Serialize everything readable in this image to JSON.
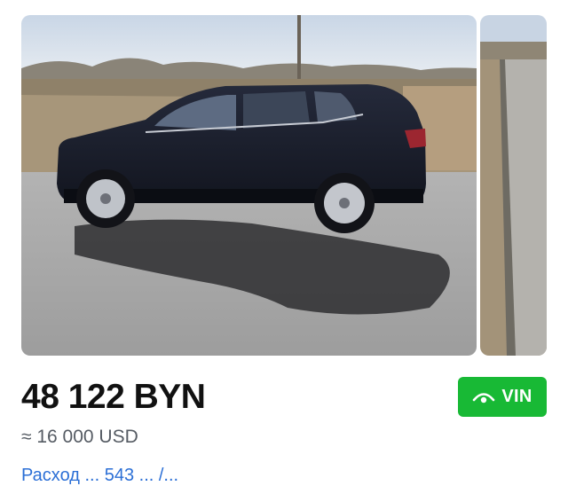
{
  "gallery": {
    "photos": [
      {
        "alt": "car-side-photo"
      },
      {
        "alt": "road-photo"
      }
    ]
  },
  "listing": {
    "price": "48 122 BYN",
    "price_usd": "≈ 16 000 USD",
    "vin_label": "VIN",
    "partial_link": "Расход ... 543 ... /..."
  },
  "colors": {
    "vin_badge": "#18b935",
    "price_text": "#111111",
    "secondary_text": "#555b63",
    "link": "#2b6fd6"
  },
  "icons": {
    "vin": "eye-check-icon"
  }
}
